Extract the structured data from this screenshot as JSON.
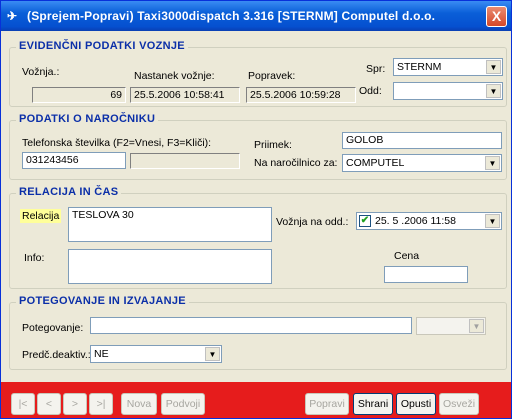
{
  "window": {
    "title": "(Sprejem-Popravi) Taxi3000dispatch 3.316 [STERNM] Computel d.o.o.",
    "close_label": "X"
  },
  "evidencni": {
    "title": "EVIDENČNI PODATKI VOZNJE",
    "voznja_label": "Vožnja.:",
    "voznja_value": "69",
    "nastanek_label": "Nastanek vožnje:",
    "nastanek_value": "25.5.2006 10:58:41",
    "popravek_label": "Popravek:",
    "popravek_value": "25.5.2006 10:59:28",
    "spr_label": "Spr:",
    "spr_value": "STERNM",
    "odd_label": "Odd:",
    "odd_value": ""
  },
  "narocnik": {
    "title": "PODATKI O NAROČNIKU",
    "telefon_label": "Telefonska številka (F2=Vnesi, F3=Kliči):",
    "telefon_value": "031243456",
    "telefon2_value": "",
    "priimek_label": "Priimek:",
    "priimek_value": "GOLOB",
    "narocilnica_label": "Na naročilnico za:",
    "narocilnica_value": "COMPUTEL"
  },
  "relacija": {
    "title": "RELACIJA IN ČAS",
    "relacija_label": "Relacija",
    "relacija_value": "TESLOVA 30",
    "info_label": "Info:",
    "info_value": "",
    "voznja_odd_label": "Vožnja na odd.:",
    "voznja_odd_value": "25. 5 .2006 11:58",
    "cena_label": "Cena",
    "cena_value": ""
  },
  "potegovanje": {
    "title": "POTEGOVANJE IN IZVAJANJE",
    "potegovanje_label": "Potegovanje:",
    "potegovanje_value": "",
    "deaktiv_label": "Predč.deaktiv.:",
    "deaktiv_value": "NE"
  },
  "buttons": {
    "first": "|<",
    "prev": "<",
    "next": ">",
    "last": ">|",
    "nova": "Nova",
    "podvoji": "Podvoji",
    "popravi": "Popravi",
    "shrani": "Shrani",
    "opusti": "Opusti",
    "osvezi": "Osveži"
  },
  "icons": {
    "app": "taxi-app-icon",
    "dropdown": "chevron-down-icon",
    "check": "checkmark-icon"
  },
  "colors": {
    "titlebar": "#0a5fd8",
    "group_title": "#0b2fa8",
    "bottom_bar": "#e61c1c",
    "highlight": "#ffff99"
  }
}
